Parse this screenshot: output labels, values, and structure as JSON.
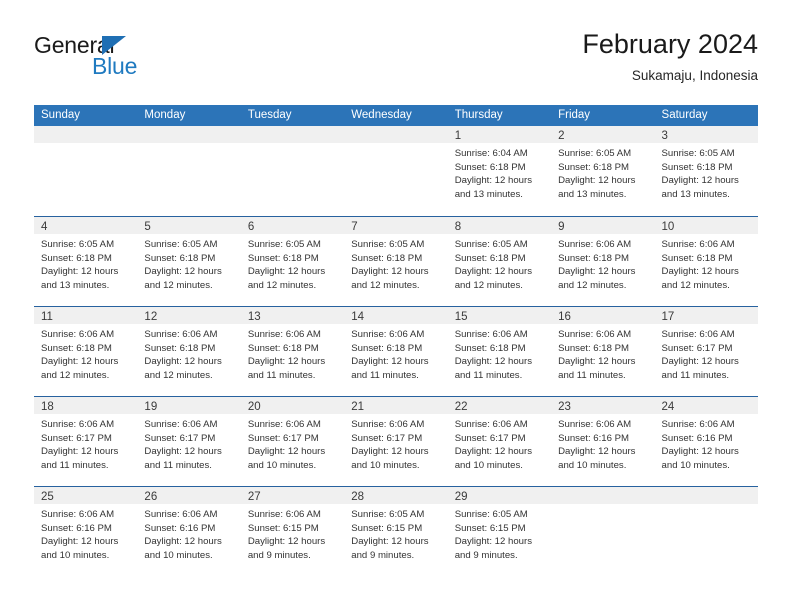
{
  "brand": {
    "name_top": "General",
    "name_bottom": "Blue",
    "triangle_color": "#1f6fb4",
    "blue_text_color": "#1f7ac0"
  },
  "header": {
    "title": "February 2024",
    "subtitle": "Sukamaju, Indonesia"
  },
  "colors": {
    "header_blue": "#2c74b8",
    "row_divider_blue": "#27629f",
    "day_band_gray": "#f0f0f0"
  },
  "weekdays": [
    "Sunday",
    "Monday",
    "Tuesday",
    "Wednesday",
    "Thursday",
    "Friday",
    "Saturday"
  ],
  "weeks": [
    [
      {
        "day": "",
        "lines": []
      },
      {
        "day": "",
        "lines": []
      },
      {
        "day": "",
        "lines": []
      },
      {
        "day": "",
        "lines": []
      },
      {
        "day": "1",
        "lines": [
          "Sunrise: 6:04 AM",
          "Sunset: 6:18 PM",
          "Daylight: 12 hours",
          "and 13 minutes."
        ]
      },
      {
        "day": "2",
        "lines": [
          "Sunrise: 6:05 AM",
          "Sunset: 6:18 PM",
          "Daylight: 12 hours",
          "and 13 minutes."
        ]
      },
      {
        "day": "3",
        "lines": [
          "Sunrise: 6:05 AM",
          "Sunset: 6:18 PM",
          "Daylight: 12 hours",
          "and 13 minutes."
        ]
      }
    ],
    [
      {
        "day": "4",
        "lines": [
          "Sunrise: 6:05 AM",
          "Sunset: 6:18 PM",
          "Daylight: 12 hours",
          "and 13 minutes."
        ]
      },
      {
        "day": "5",
        "lines": [
          "Sunrise: 6:05 AM",
          "Sunset: 6:18 PM",
          "Daylight: 12 hours",
          "and 12 minutes."
        ]
      },
      {
        "day": "6",
        "lines": [
          "Sunrise: 6:05 AM",
          "Sunset: 6:18 PM",
          "Daylight: 12 hours",
          "and 12 minutes."
        ]
      },
      {
        "day": "7",
        "lines": [
          "Sunrise: 6:05 AM",
          "Sunset: 6:18 PM",
          "Daylight: 12 hours",
          "and 12 minutes."
        ]
      },
      {
        "day": "8",
        "lines": [
          "Sunrise: 6:05 AM",
          "Sunset: 6:18 PM",
          "Daylight: 12 hours",
          "and 12 minutes."
        ]
      },
      {
        "day": "9",
        "lines": [
          "Sunrise: 6:06 AM",
          "Sunset: 6:18 PM",
          "Daylight: 12 hours",
          "and 12 minutes."
        ]
      },
      {
        "day": "10",
        "lines": [
          "Sunrise: 6:06 AM",
          "Sunset: 6:18 PM",
          "Daylight: 12 hours",
          "and 12 minutes."
        ]
      }
    ],
    [
      {
        "day": "11",
        "lines": [
          "Sunrise: 6:06 AM",
          "Sunset: 6:18 PM",
          "Daylight: 12 hours",
          "and 12 minutes."
        ]
      },
      {
        "day": "12",
        "lines": [
          "Sunrise: 6:06 AM",
          "Sunset: 6:18 PM",
          "Daylight: 12 hours",
          "and 12 minutes."
        ]
      },
      {
        "day": "13",
        "lines": [
          "Sunrise: 6:06 AM",
          "Sunset: 6:18 PM",
          "Daylight: 12 hours",
          "and 11 minutes."
        ]
      },
      {
        "day": "14",
        "lines": [
          "Sunrise: 6:06 AM",
          "Sunset: 6:18 PM",
          "Daylight: 12 hours",
          "and 11 minutes."
        ]
      },
      {
        "day": "15",
        "lines": [
          "Sunrise: 6:06 AM",
          "Sunset: 6:18 PM",
          "Daylight: 12 hours",
          "and 11 minutes."
        ]
      },
      {
        "day": "16",
        "lines": [
          "Sunrise: 6:06 AM",
          "Sunset: 6:18 PM",
          "Daylight: 12 hours",
          "and 11 minutes."
        ]
      },
      {
        "day": "17",
        "lines": [
          "Sunrise: 6:06 AM",
          "Sunset: 6:17 PM",
          "Daylight: 12 hours",
          "and 11 minutes."
        ]
      }
    ],
    [
      {
        "day": "18",
        "lines": [
          "Sunrise: 6:06 AM",
          "Sunset: 6:17 PM",
          "Daylight: 12 hours",
          "and 11 minutes."
        ]
      },
      {
        "day": "19",
        "lines": [
          "Sunrise: 6:06 AM",
          "Sunset: 6:17 PM",
          "Daylight: 12 hours",
          "and 11 minutes."
        ]
      },
      {
        "day": "20",
        "lines": [
          "Sunrise: 6:06 AM",
          "Sunset: 6:17 PM",
          "Daylight: 12 hours",
          "and 10 minutes."
        ]
      },
      {
        "day": "21",
        "lines": [
          "Sunrise: 6:06 AM",
          "Sunset: 6:17 PM",
          "Daylight: 12 hours",
          "and 10 minutes."
        ]
      },
      {
        "day": "22",
        "lines": [
          "Sunrise: 6:06 AM",
          "Sunset: 6:17 PM",
          "Daylight: 12 hours",
          "and 10 minutes."
        ]
      },
      {
        "day": "23",
        "lines": [
          "Sunrise: 6:06 AM",
          "Sunset: 6:16 PM",
          "Daylight: 12 hours",
          "and 10 minutes."
        ]
      },
      {
        "day": "24",
        "lines": [
          "Sunrise: 6:06 AM",
          "Sunset: 6:16 PM",
          "Daylight: 12 hours",
          "and 10 minutes."
        ]
      }
    ],
    [
      {
        "day": "25",
        "lines": [
          "Sunrise: 6:06 AM",
          "Sunset: 6:16 PM",
          "Daylight: 12 hours",
          "and 10 minutes."
        ]
      },
      {
        "day": "26",
        "lines": [
          "Sunrise: 6:06 AM",
          "Sunset: 6:16 PM",
          "Daylight: 12 hours",
          "and 10 minutes."
        ]
      },
      {
        "day": "27",
        "lines": [
          "Sunrise: 6:06 AM",
          "Sunset: 6:15 PM",
          "Daylight: 12 hours",
          "and 9 minutes."
        ]
      },
      {
        "day": "28",
        "lines": [
          "Sunrise: 6:05 AM",
          "Sunset: 6:15 PM",
          "Daylight: 12 hours",
          "and 9 minutes."
        ]
      },
      {
        "day": "29",
        "lines": [
          "Sunrise: 6:05 AM",
          "Sunset: 6:15 PM",
          "Daylight: 12 hours",
          "and 9 minutes."
        ]
      },
      {
        "day": "",
        "lines": []
      },
      {
        "day": "",
        "lines": []
      }
    ]
  ]
}
